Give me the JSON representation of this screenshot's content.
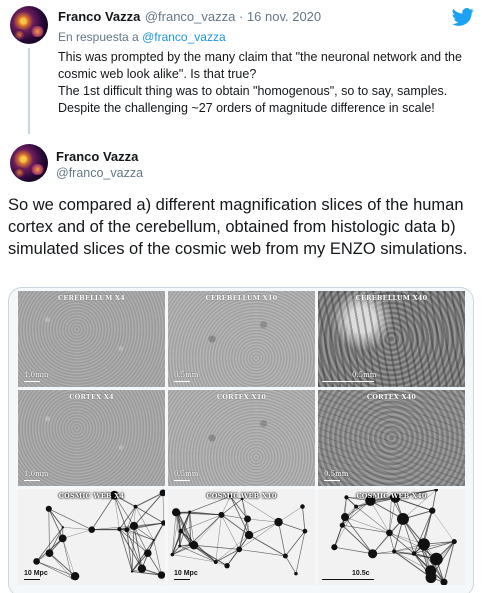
{
  "reply_tweet": {
    "author_name": "Franco Vazza",
    "author_handle": "@franco_vazza",
    "separator": " · ",
    "date": "16 nov. 2020",
    "reply_prefix": "En respuesta a ",
    "reply_to": "@franco_vazza",
    "lines": [
      "This was prompted by the many claim that \"the neuronal network and the cosmic web look alike\". Is that true?",
      "The 1st difficult thing was to obtain \"homogenous\", so to say, samples. Despite the challenging ~27 orders of magnitude difference in scale!"
    ]
  },
  "main_tweet": {
    "author_name": "Franco Vazza",
    "author_handle": "@franco_vazza",
    "text": "So we compared a) different magnification slices of the human cortex and of the cerebellum, obtained from histologic data b) simulated slices of the cosmic web from my ENZO simulations."
  },
  "media": {
    "panels": [
      {
        "title": "CEREBELLUM X4",
        "scale": "1.0mm",
        "kind": "tissue-a"
      },
      {
        "title": "CEREBELLUM X10",
        "scale": "0.5mm",
        "kind": "tissue-b"
      },
      {
        "title": "CEREBELLUM X40",
        "scale": "0.5mm",
        "kind": "tissue-c"
      },
      {
        "title": "CORTEX X4",
        "scale": "1.0mm",
        "kind": "tissue-a"
      },
      {
        "title": "CORTEX X10",
        "scale": "0.5mm",
        "kind": "tissue-b"
      },
      {
        "title": "CORTEX X40",
        "scale": "0.5mm",
        "kind": "tissue-d"
      },
      {
        "title": "COSMIC WEB X4",
        "scale": "10 Mpc",
        "kind": "cosmic"
      },
      {
        "title": "COSMIC WEB X10",
        "scale": "10 Mpc",
        "kind": "cosmic"
      },
      {
        "title": "COSMIC WEB X40",
        "scale": "10.5c",
        "kind": "cosmic"
      }
    ]
  },
  "icons": {
    "twitter": "twitter-bird-icon"
  },
  "colors": {
    "link": "#1b95e0",
    "twitter_blue": "#1da1f2",
    "muted": "#657786"
  }
}
